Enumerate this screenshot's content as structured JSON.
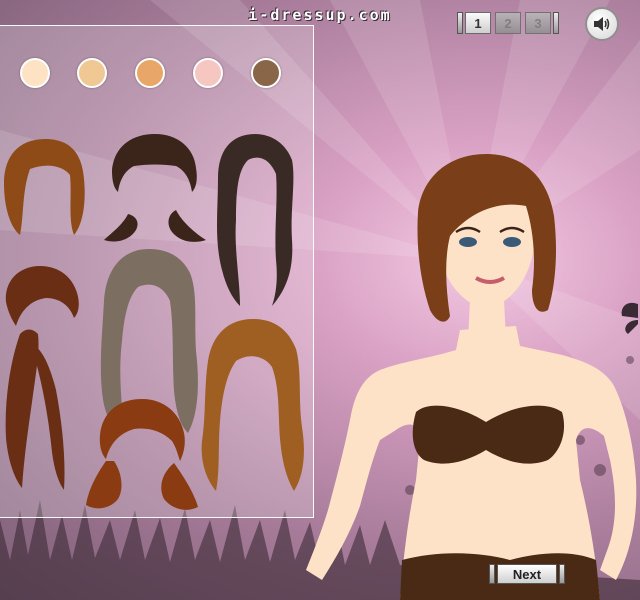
{
  "header": {
    "site_title": "i-dressup.com"
  },
  "pagination": {
    "pages": [
      "1",
      "2",
      "3"
    ],
    "current": "1"
  },
  "sound_button": {
    "icon": "speaker-icon"
  },
  "skin_tones": [
    "#fde3c4",
    "#f0c894",
    "#e8a668",
    "#f6c6c1",
    "#8a6648"
  ],
  "hair_options": [
    {
      "name": "short-bob",
      "color": "#8e4a17"
    },
    {
      "name": "bangs-pigtails",
      "color": "#3b2419"
    },
    {
      "name": "long-wavy-dark",
      "color": "#3a2a26"
    },
    {
      "name": "side-ponytail",
      "color": "#6a2e15"
    },
    {
      "name": "long-ash",
      "color": "#7c6f62"
    },
    {
      "name": "wavy-caramel",
      "color": "#a05f22"
    },
    {
      "name": "auburn-pigtails",
      "color": "#8a3b12"
    }
  ],
  "model": {
    "hair_color": "#7a3f18",
    "skin_color": "#fde2c7",
    "bikini_color": "#4a2a14"
  },
  "next_button": {
    "label": "Next"
  }
}
